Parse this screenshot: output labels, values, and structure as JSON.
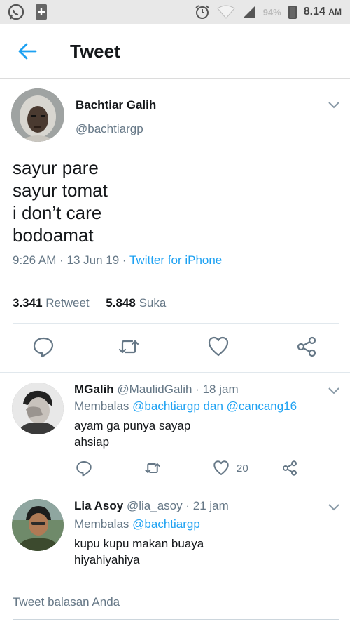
{
  "status_bar": {
    "battery": "94%",
    "time": "8.14",
    "ampm": "AM",
    "icons": [
      "whatsapp-icon",
      "notification-plus-icon",
      "alarm-icon",
      "wifi-icon",
      "signal-icon",
      "battery-icon"
    ]
  },
  "header": {
    "title": "Tweet",
    "back_icon": "arrow-left-icon"
  },
  "tweet": {
    "author_name": "Bachtiar Galih",
    "author_handle": "@bachtiargp",
    "lines": [
      "sayur pare",
      "sayur tomat",
      "i don’t care",
      "bodoamat"
    ],
    "time": "9:26 AM",
    "date": "13 Jun 19",
    "source": "Twitter for iPhone",
    "retweets_count": "3.341",
    "retweets_label": "Retweet",
    "likes_count": "5.848",
    "likes_label": "Suka"
  },
  "replies": [
    {
      "name": "MGalih",
      "handle": "@MaulidGalih",
      "time": "18 jam",
      "replying_prefix": "Membalas",
      "mention1": "@bachtiargp",
      "joiner": "dan",
      "mention2": "@cancang16",
      "lines": [
        "ayam ga punya sayap",
        "ahsiap"
      ],
      "like_count": "20"
    },
    {
      "name": "Lia Asoy",
      "handle": "@lia_asoy",
      "time": "21 jam",
      "replying_prefix": "Membalas",
      "mention1": "@bachtiargp",
      "lines": [
        "kupu kupu makan buaya",
        "hiyahiyahiya"
      ]
    }
  ],
  "compose": {
    "placeholder": "Tweet balasan Anda"
  },
  "colors": {
    "accent": "#1da1f2",
    "secondary_text": "#657786",
    "primary_text": "#14171a",
    "divider": "#e1e8ed"
  }
}
